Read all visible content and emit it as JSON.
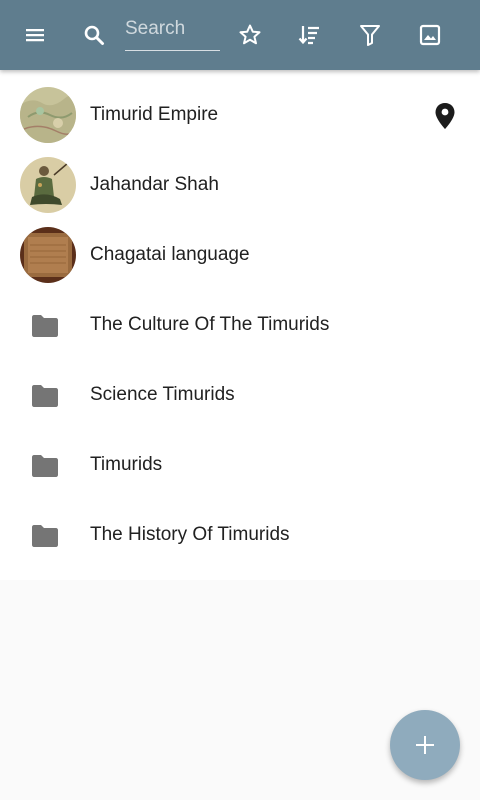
{
  "toolbar": {
    "search_placeholder": "Search",
    "icons": [
      "menu-icon",
      "search-icon",
      "star-icon",
      "sort-icon",
      "filter-icon",
      "image-icon"
    ],
    "background_color": "#5f7d8e"
  },
  "list": {
    "items": [
      {
        "label": "Timurid Empire",
        "type": "article",
        "thumbnail": "map-thumbnail",
        "has_location": true
      },
      {
        "label": "Jahandar Shah",
        "type": "article",
        "thumbnail": "portrait-thumbnail",
        "has_location": false
      },
      {
        "label": "Chagatai language",
        "type": "article",
        "thumbnail": "manuscript-thumbnail",
        "has_location": false
      },
      {
        "label": "The Culture Of The Timurids",
        "type": "folder"
      },
      {
        "label": "Science Timurids",
        "type": "folder"
      },
      {
        "label": "Timurids",
        "type": "folder"
      },
      {
        "label": "The History Of Timurids",
        "type": "folder"
      }
    ]
  },
  "fab": {
    "icon": "plus-icon",
    "color": "#8fabbd"
  }
}
